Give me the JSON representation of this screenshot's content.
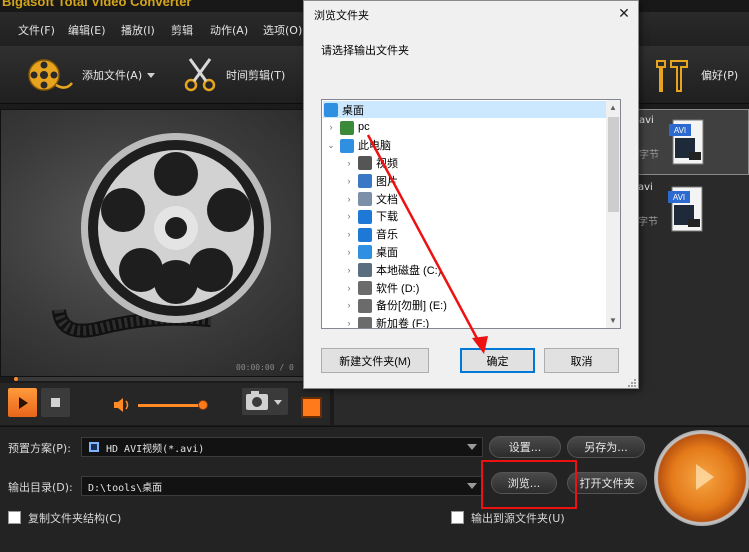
{
  "app": {
    "brand": "Bigasoft Total Video Converter"
  },
  "menu": [
    "文件(F)",
    "编辑(E)",
    "播放(I)",
    "剪辑",
    "动作(A)",
    "选项(O)"
  ],
  "toolbar": {
    "add_file": "添加文件(A)",
    "time_clip": "时间剪辑(T)",
    "preference": "偏好(P)"
  },
  "player": {
    "timecode": "00:00:00 / 0"
  },
  "files": [
    {
      "name": "avi",
      "sub": "字节",
      "badge": "AVI"
    },
    {
      "name": "avi",
      "sub": "字节",
      "badge": "AVI"
    }
  ],
  "bottom": {
    "preset_label": "预置方案(P):",
    "preset_value": "HD AVI视频(*.avi)",
    "output_label": "输出目录(D):",
    "output_value": "D:\\tools\\桌面",
    "settings_btn": "设置...",
    "save_as_btn": "另存为...",
    "browse_btn": "浏览...",
    "open_folder_btn": "打开文件夹",
    "copy_structure": "复制文件夹结构(C)",
    "output_to_source": "输出到源文件夹(U)"
  },
  "dialog": {
    "title": "浏览文件夹",
    "close": "✕",
    "prompt": "请选择输出文件夹",
    "tree": [
      {
        "label": "桌面",
        "level": 0,
        "expander": "",
        "icon": "desktop-icon",
        "selected": true
      },
      {
        "label": "pc",
        "level": 1,
        "expander": "›",
        "icon": "user-icon",
        "selected": false
      },
      {
        "label": "此电脑",
        "level": 1,
        "expander": "⌄",
        "icon": "computer-icon",
        "selected": false
      },
      {
        "label": "视频",
        "level": 2,
        "expander": "›",
        "icon": "video-folder-icon",
        "selected": false
      },
      {
        "label": "图片",
        "level": 2,
        "expander": "›",
        "icon": "pictures-folder-icon",
        "selected": false
      },
      {
        "label": "文档",
        "level": 2,
        "expander": "›",
        "icon": "documents-folder-icon",
        "selected": false
      },
      {
        "label": "下载",
        "level": 2,
        "expander": "›",
        "icon": "download-icon",
        "selected": false
      },
      {
        "label": "音乐",
        "level": 2,
        "expander": "›",
        "icon": "music-icon",
        "selected": false
      },
      {
        "label": "桌面",
        "level": 2,
        "expander": "›",
        "icon": "desktop-icon",
        "selected": false
      },
      {
        "label": "本地磁盘 (C:)",
        "level": 2,
        "expander": "›",
        "icon": "system-drive-icon",
        "selected": false
      },
      {
        "label": "软件 (D:)",
        "level": 2,
        "expander": "›",
        "icon": "drive-icon",
        "selected": false
      },
      {
        "label": "备份[勿删] (E:)",
        "level": 2,
        "expander": "›",
        "icon": "drive-icon",
        "selected": false
      },
      {
        "label": "新加卷 (F:)",
        "level": 2,
        "expander": "›",
        "icon": "drive-icon",
        "selected": false
      }
    ],
    "new_folder_btn": "新建文件夹(M)",
    "ok_btn": "确定",
    "cancel_btn": "取消"
  },
  "colors": {
    "accent": "#ff8a26",
    "annotation": "#e11111",
    "selection": "#cce8ff"
  }
}
